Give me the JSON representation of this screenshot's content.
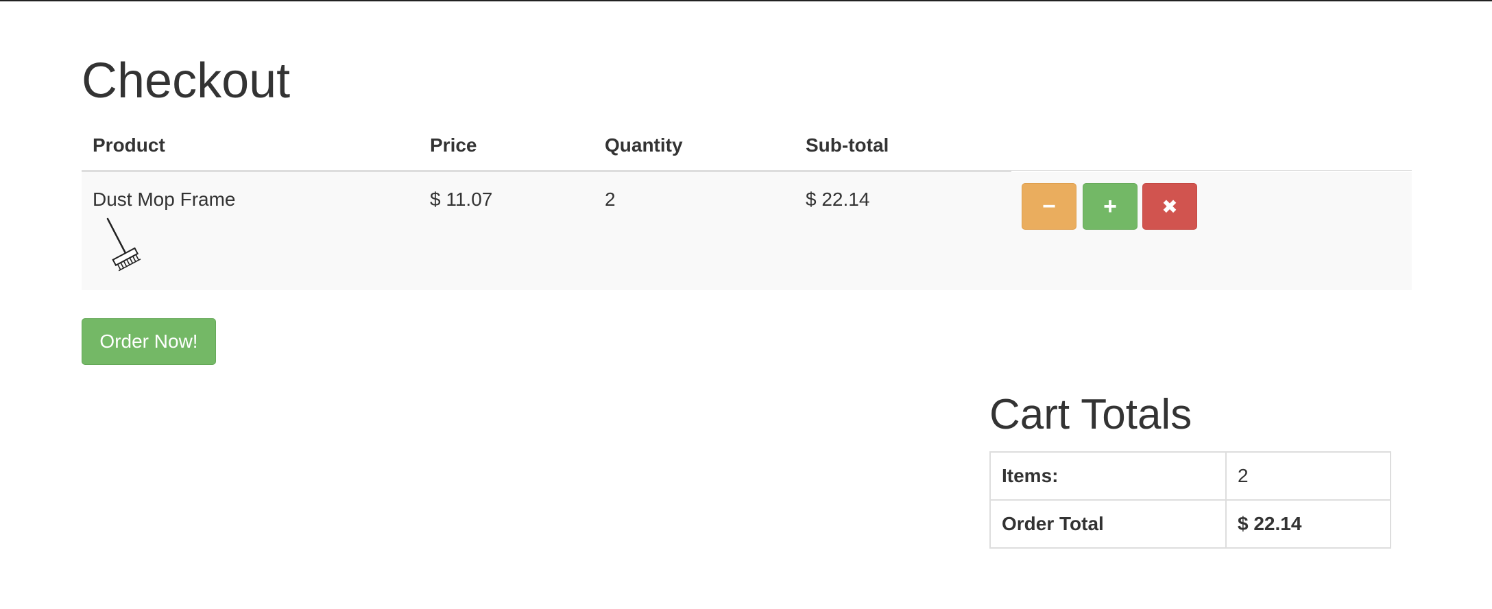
{
  "page": {
    "title": "Checkout"
  },
  "cart": {
    "columns": [
      "Product",
      "Price",
      "Quantity",
      "Sub-total"
    ],
    "items": [
      {
        "product": "Dust Mop Frame",
        "icon": "dust-mop-icon",
        "price": "$ 11.07",
        "quantity": "2",
        "subtotal": "$ 22.14"
      }
    ],
    "actions": {
      "decrease_label": "−",
      "increase_label": "+",
      "remove_label": "✖"
    }
  },
  "order_button": "Order Now!",
  "totals": {
    "title": "Cart Totals",
    "items_label": "Items:",
    "items_value": "2",
    "order_total_label": "Order Total",
    "order_total_value": "$ 22.14"
  },
  "colors": {
    "warning": "#eaad5e",
    "success": "#73b866",
    "danger": "#d1544f"
  }
}
